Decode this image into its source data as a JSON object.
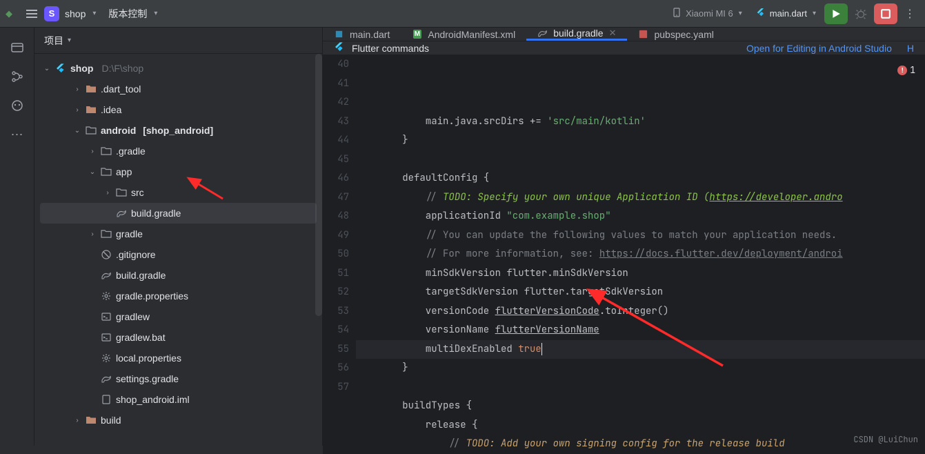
{
  "toolbar": {
    "project_name": "shop",
    "vc_label": "版本控制",
    "device": "Xiaomi MI 6",
    "run_config": "main.dart"
  },
  "sidebar": {
    "title": "项目",
    "root": {
      "name": "shop",
      "path": "D:\\F\\shop"
    },
    "nodes": [
      {
        "label": ".dart_tool",
        "type": "folder-ex",
        "indent": 2,
        "arrow": "›"
      },
      {
        "label": ".idea",
        "type": "folder-ex",
        "indent": 2,
        "arrow": "›"
      },
      {
        "label": "android",
        "hint": "[shop_android]",
        "type": "folder",
        "indent": 2,
        "arrow": "⌄",
        "bold": true
      },
      {
        "label": ".gradle",
        "type": "folder",
        "indent": 3,
        "arrow": "›"
      },
      {
        "label": "app",
        "type": "folder",
        "indent": 3,
        "arrow": "⌄"
      },
      {
        "label": "src",
        "type": "folder",
        "indent": 4,
        "arrow": "›"
      },
      {
        "label": "build.gradle",
        "type": "gradle",
        "indent": 4,
        "selected": true
      },
      {
        "label": "gradle",
        "type": "folder",
        "indent": 3,
        "arrow": "›"
      },
      {
        "label": ".gitignore",
        "type": "git",
        "indent": 3
      },
      {
        "label": "build.gradle",
        "type": "gradle",
        "indent": 3
      },
      {
        "label": "gradle.properties",
        "type": "gear",
        "indent": 3
      },
      {
        "label": "gradlew",
        "type": "sh",
        "indent": 3
      },
      {
        "label": "gradlew.bat",
        "type": "sh",
        "indent": 3
      },
      {
        "label": "local.properties",
        "type": "gear",
        "indent": 3
      },
      {
        "label": "settings.gradle",
        "type": "gradle",
        "indent": 3
      },
      {
        "label": "shop_android.iml",
        "type": "iml",
        "indent": 3
      },
      {
        "label": "build",
        "type": "folder-ex",
        "indent": 2,
        "arrow": "›"
      }
    ]
  },
  "tabs": [
    {
      "label": "main.dart",
      "icon": "dart"
    },
    {
      "label": "AndroidManifest.xml",
      "icon": "manifest"
    },
    {
      "label": "build.gradle",
      "icon": "gradle",
      "active": true,
      "closeable": true
    },
    {
      "label": "pubspec.yaml",
      "icon": "yaml"
    }
  ],
  "banner": {
    "label": "Flutter commands",
    "link": "Open for Editing in Android Studio",
    "extra": "H"
  },
  "errors": {
    "count": "1"
  },
  "gutter_start": 40,
  "code_lines": [
    [
      {
        "t": "            main.java.srcDirs += ",
        "c": "plain"
      },
      {
        "t": "'src/main/kotlin'",
        "c": "str"
      }
    ],
    [
      {
        "t": "        }",
        "c": "plain"
      }
    ],
    [
      {
        "t": "",
        "c": "plain"
      }
    ],
    [
      {
        "t": "        defaultConfig {",
        "c": "plain"
      }
    ],
    [
      {
        "t": "            ",
        "c": "plain"
      },
      {
        "t": "// ",
        "c": "cmt"
      },
      {
        "t": "TODO: Specify your own unique Application ID (",
        "c": "todo"
      },
      {
        "t": "https://developer.andro",
        "c": "todo und"
      }
    ],
    [
      {
        "t": "            applicationId ",
        "c": "plain"
      },
      {
        "t": "\"com.example.shop\"",
        "c": "str"
      }
    ],
    [
      {
        "t": "            ",
        "c": "plain"
      },
      {
        "t": "// You can update the following values to match your application needs.",
        "c": "cmt"
      }
    ],
    [
      {
        "t": "            ",
        "c": "plain"
      },
      {
        "t": "// For more information, see: ",
        "c": "cmt"
      },
      {
        "t": "https://docs.flutter.dev/deployment/androi",
        "c": "lnk"
      }
    ],
    [
      {
        "t": "            minSdkVersion flutter.minSdkVersion",
        "c": "plain"
      }
    ],
    [
      {
        "t": "            targetSdkVersion flutter.targetSdkVersion",
        "c": "plain"
      }
    ],
    [
      {
        "t": "            versionCode ",
        "c": "plain"
      },
      {
        "t": "flutterVersionCode",
        "c": "plain und"
      },
      {
        "t": ".toInteger()",
        "c": "plain"
      }
    ],
    [
      {
        "t": "            versionName ",
        "c": "plain"
      },
      {
        "t": "flutterVersionName",
        "c": "plain und"
      }
    ],
    [
      {
        "t": "            multiDexEnabled ",
        "c": "plain"
      },
      {
        "t": "true",
        "c": "kw"
      },
      {
        "cursor": true
      }
    ],
    [
      {
        "t": "        }",
        "c": "plain"
      }
    ],
    [
      {
        "t": "",
        "c": "plain"
      }
    ],
    [
      {
        "t": "        buildTypes {",
        "c": "plain"
      }
    ],
    [
      {
        "t": "            release {",
        "c": "plain"
      }
    ],
    [
      {
        "t": "                ",
        "c": "plain"
      },
      {
        "t": "// ",
        "c": "cmt"
      },
      {
        "t": "TODO: Add your own signing config for the release build",
        "c": "todoy"
      }
    ]
  ],
  "watermark": "CSDN @LuiChun"
}
